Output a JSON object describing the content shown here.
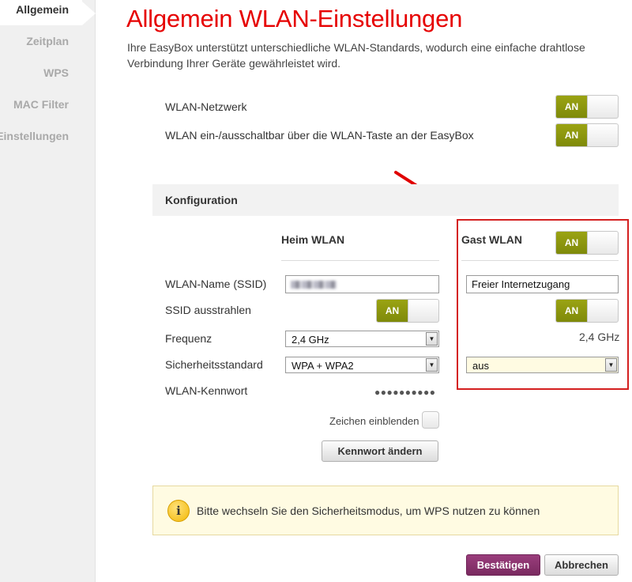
{
  "sidebar": {
    "items": [
      {
        "label": "Allgemein",
        "active": true
      },
      {
        "label": "Zeitplan",
        "active": false
      },
      {
        "label": "WPS",
        "active": false
      },
      {
        "label": "MAC Filter",
        "active": false
      },
      {
        "label": "Einstellungen",
        "active": false
      }
    ]
  },
  "page": {
    "title": "Allgemein WLAN-Einstellungen",
    "intro": "Ihre EasyBox unterstützt unterschiedliche WLAN-Standards, wodurch eine einfache drahtlose Verbindung Ihrer Geräte gewährleistet wird."
  },
  "general": {
    "wlan_network_label": "WLAN-Netzwerk",
    "wlan_network_toggle": "AN",
    "wlan_button_label": "WLAN ein-/ausschaltbar über die WLAN-Taste an der EasyBox",
    "wlan_button_toggle": "AN"
  },
  "config": {
    "header": "Konfiguration",
    "home_title": "Heim WLAN",
    "guest_title": "Gast WLAN",
    "guest_toggle": "AN",
    "ssid_label": "WLAN-Name (SSID)",
    "home_ssid_value": "",
    "guest_ssid_value": "Freier Internetzugang",
    "broadcast_label": "SSID ausstrahlen",
    "home_broadcast_toggle": "AN",
    "guest_broadcast_toggle": "AN",
    "frequency_label": "Frequenz",
    "home_frequency": "2,4 GHz",
    "guest_frequency": "2,4 GHz",
    "security_label": "Sicherheitsstandard",
    "home_security": "WPA + WPA2",
    "guest_security": "aus",
    "password_label": "WLAN-Kennwort",
    "password_mask": "●●●●●●●●●●",
    "show_chars_label": "Zeichen einblenden",
    "change_password_button": "Kennwort ändern"
  },
  "info": {
    "icon": "info-icon",
    "icon_glyph": "i",
    "text": "Bitte wechseln Sie den Sicherheitsmodus, um WPS nutzen zu können"
  },
  "actions": {
    "confirm": "Bestätigen",
    "cancel": "Abbrechen"
  },
  "colors": {
    "title_red": "#e60000",
    "toggle_on": "#8c960f",
    "confirm_purple": "#8a3370",
    "highlight_box": "#d42020",
    "arrow": "#e00000"
  }
}
